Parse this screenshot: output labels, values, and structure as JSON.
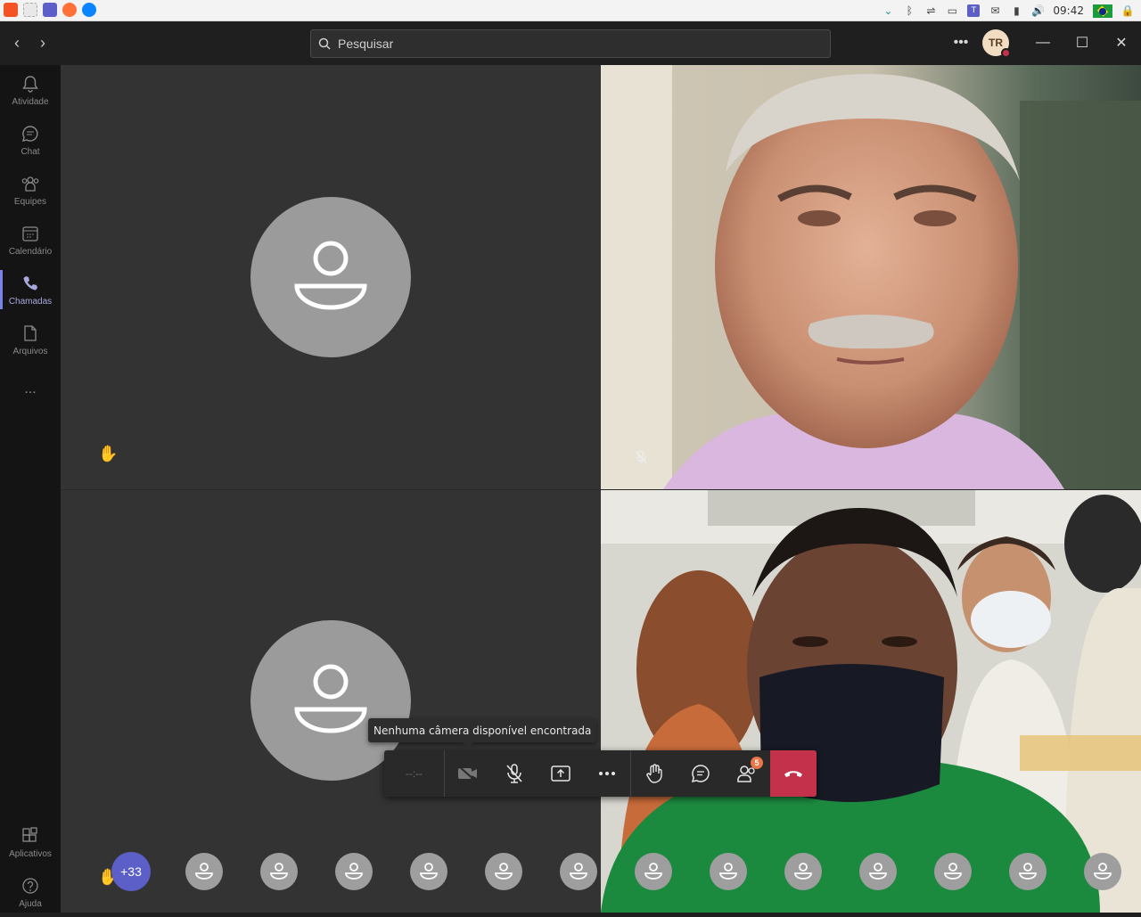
{
  "taskbar": {
    "time": "09:42",
    "flag_colors": [
      "#1a9b3c",
      "#ffd400",
      "#0b2a8a"
    ]
  },
  "titlebar": {
    "search_placeholder": "Pesquisar",
    "avatar_initials": "TR",
    "presence_color": "#c4314b"
  },
  "rail": {
    "items": [
      {
        "label": "Atividade",
        "icon": "bell-icon"
      },
      {
        "label": "Chat",
        "icon": "chat-icon"
      },
      {
        "label": "Equipes",
        "icon": "teams-icon"
      },
      {
        "label": "Calendário",
        "icon": "calendar-icon"
      },
      {
        "label": "Chamadas",
        "icon": "phone-icon",
        "active": true
      },
      {
        "label": "Arquivos",
        "icon": "file-icon"
      }
    ],
    "more": "...",
    "apps_label": "Aplicativos",
    "help_label": "Ajuda"
  },
  "callbar": {
    "timer": "--:--",
    "tooltip": "Nenhuma câmera disponível encontrada",
    "participants_badge": "5",
    "end_color": "#c4314b",
    "icons": [
      "camera-off-icon",
      "mic-off-icon",
      "share-icon",
      "more-icon",
      "raise-hand-icon",
      "chat-icon",
      "participants-icon",
      "hang-up-icon"
    ]
  },
  "roster": {
    "more_count": "+33",
    "avatar_count": 13
  }
}
